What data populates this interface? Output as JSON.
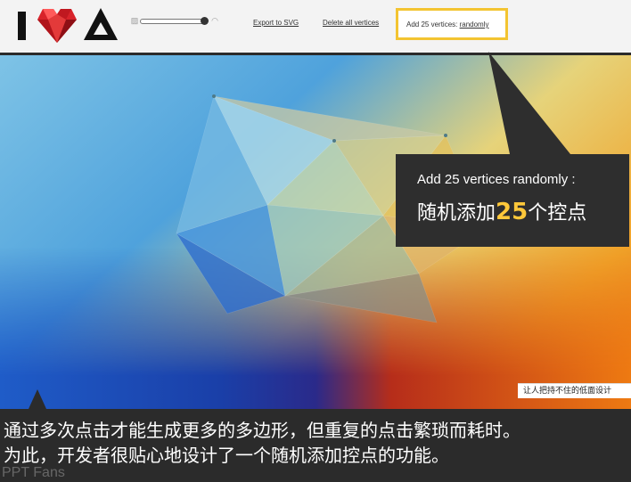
{
  "toolbar": {
    "export_label": "Export to SVG",
    "delete_label": "Delete all vertices",
    "add_prefix": "Add 25 vertices: ",
    "add_link": "randomly",
    "slider_left_icon": "image-icon",
    "slider_right_icon": "wifi-icon"
  },
  "callout": {
    "english": "Add 25 vertices randomly :",
    "chinese_before": "随机添加",
    "chinese_number": "25",
    "chinese_after": "个控点",
    "highlight_color": "#ffc83a"
  },
  "watermark": {
    "text": "让人把持不住的低面设计"
  },
  "caption": {
    "line1": "通过多次点击才能生成更多的多边形，但重复的点击繁琐而耗时。",
    "line2": "为此，开发者很贴心地设计了一个随机添加控点的功能。",
    "brand": "PPT Fans"
  },
  "colors": {
    "toolbar_bg": "#f3f3f3",
    "highlight_border": "#f3c431",
    "panel_dark": "#2e2e2e",
    "logo_red": "#d8232a"
  }
}
